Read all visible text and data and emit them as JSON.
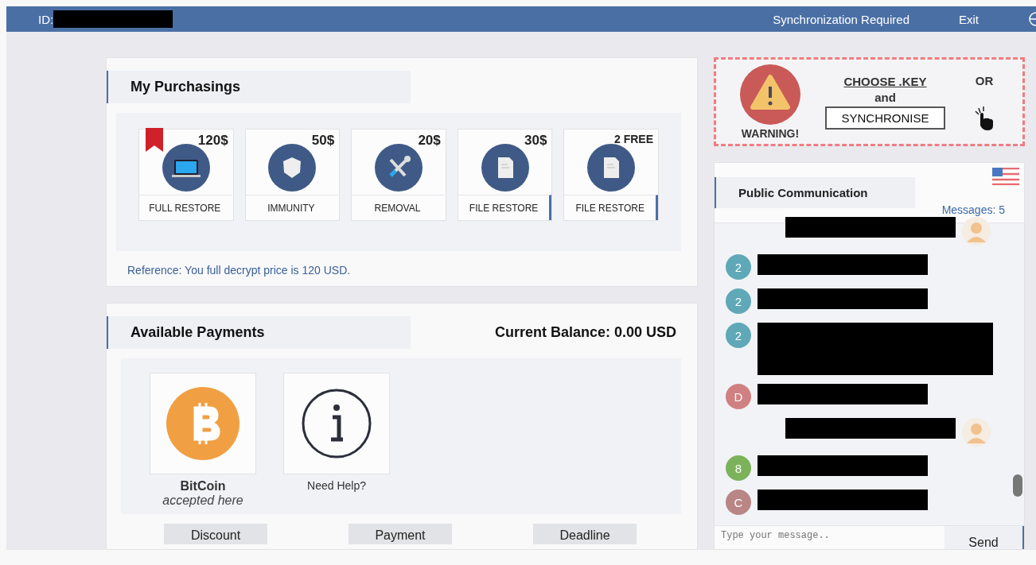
{
  "header": {
    "id_label": "ID:",
    "links": [
      "Synchronization Required",
      "Exit"
    ]
  },
  "purchasings": {
    "title": "My Purchasings",
    "items": [
      {
        "price": "120$",
        "label": "FULL RESTORE",
        "kind": "laptop",
        "bookmarked": true,
        "marked": false
      },
      {
        "price": "50$",
        "label": "IMMUNITY",
        "kind": "shield",
        "bookmarked": false,
        "marked": false
      },
      {
        "price": "20$",
        "label": "REMOVAL",
        "kind": "tools",
        "bookmarked": false,
        "marked": false
      },
      {
        "price": "30$",
        "label": "FILE RESTORE",
        "kind": "document",
        "bookmarked": false,
        "marked": true
      },
      {
        "price": "2 FREE",
        "label": "FILE RESTORE",
        "kind": "document",
        "bookmarked": false,
        "marked": true
      }
    ],
    "reference": "Reference: You full decrypt price is 120 USD."
  },
  "payments": {
    "title": "Available Payments",
    "balance": "Current Balance: 0.00 USD",
    "methods": [
      {
        "kind": "bitcoin",
        "title": "BitCoin",
        "subtitle": "accepted here"
      },
      {
        "kind": "help",
        "title": "Need Help?"
      }
    ],
    "buttons": [
      "Discount",
      "Payment",
      "Deadline"
    ]
  },
  "warning": {
    "caption": "WARNING!",
    "choose": "CHOOSE .KEY",
    "and": "and",
    "synchronise": "SYNCHRONISE",
    "or": "OR"
  },
  "chat": {
    "title": "Public Communication",
    "count": "Messages: 5",
    "placeholder": "Type your message..",
    "send": "Send",
    "messages": [
      {
        "kind": "outgoing"
      },
      {
        "kind": "incoming",
        "avatar": "2",
        "color": "#5fa8b8"
      },
      {
        "kind": "incoming",
        "avatar": "2",
        "color": "#5fa8b8"
      },
      {
        "kind": "longincoming",
        "avatar": "2",
        "color": "#5fa8b8"
      },
      {
        "kind": "incoming",
        "avatar": "D",
        "color": "#d08080"
      },
      {
        "kind": "outgoing"
      },
      {
        "kind": "incoming",
        "avatar": "8",
        "color": "#7cb35a"
      },
      {
        "kind": "incoming",
        "avatar": "C",
        "color": "#b98585"
      }
    ]
  }
}
